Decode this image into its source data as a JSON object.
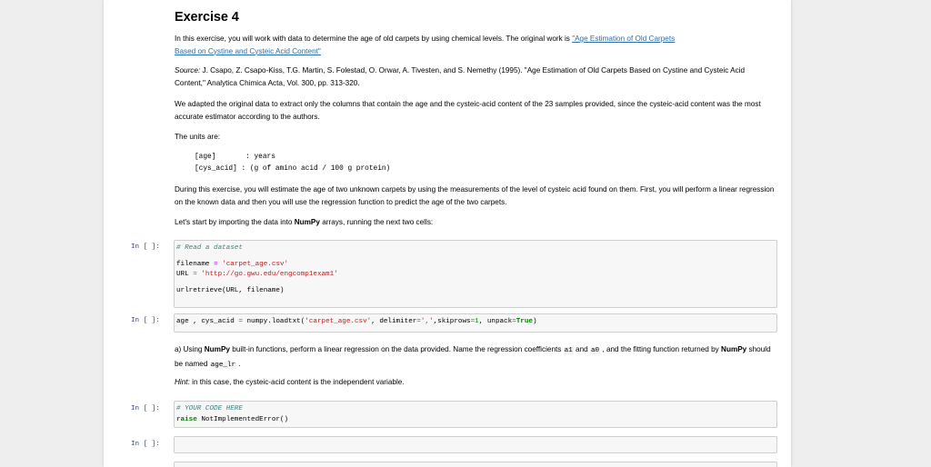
{
  "exercise": {
    "title": "Exercise 4",
    "intro": {
      "text_before_link": "In this exercise, you will work with data to determine the age of old carpets by using chemical levels. The original work is ",
      "link_line1": "\"Age Estimation of Old Carpets",
      "link_line2": "Based on Cystine and Cysteic Acid Content\""
    },
    "source": {
      "label": "Source:",
      "text": " J. Csapo, Z. Csapo-Kiss, T.G. Martin, S. Folestad, O. Orwar, A. Tivesten, and S. Nemethy (1995). \"Age Estimation of Old Carpets Based on Cystine and Cysteic Acid Content,\" Analytica Chimica Acta, Vol. 300, pp. 313-320."
    },
    "adapted": "We adapted the original data to extract only the columns that contain the age and the cysteic-acid content of the 23 samples provided, since the cysteic-acid content was the most accurate estimator according to the authors.",
    "units_label": "The units are:",
    "units_lines": [
      "[age]       : years",
      "[cys_acid] : (g of amino acid / 100 g protein)"
    ],
    "during": "During this exercise, you will estimate the age of two unknown carpets by using the measurements of the level of cysteic acid found on them. First, you will perform a linear regression on the known data and then you will use the regression function to predict the age of the two carpets.",
    "start": {
      "before": "Let's start by importing the data into ",
      "bold": "NumPy",
      "after": " arrays, running the next two cells:"
    },
    "task_a": {
      "p1": "a) Using ",
      "b1": "NumPy",
      "p2": " built-in functions, perform a linear regression on the data provided. Name the regression coefficients ",
      "c1": "a1",
      "p3": " and ",
      "c2": "a0",
      "p4": " , and the fitting function returned by ",
      "b2": "NumPy",
      "p5": " should be named ",
      "c3": "age_lr",
      "p6": " ."
    },
    "hint": {
      "label": "Hint:",
      "text": " in this case, the cysteic-acid content is the independent variable."
    }
  },
  "cells": [
    {
      "prompt": "In [ ]:",
      "comment": "# Read a dataset",
      "filename_var": "filename",
      "filename_eq": " = ",
      "filename_val": "'carpet_age.csv'",
      "url_var": "URL",
      "url_eq": " = ",
      "url_val": "'http://go.gwu.edu/engcomp1exam1'",
      "call": "urlretrieve(URL, filename)"
    },
    {
      "prompt": "In [ ]:",
      "pre": "age , cys_acid ",
      "eq": "=",
      "mid": " numpy.loadtxt(",
      "s1": "'carpet_age.csv'",
      "mid2": ", delimiter",
      "eq2": "=",
      "s2": "','",
      "mid3": ",skiprows",
      "eq3": "=",
      "n1": "1",
      "mid4": ", unpack",
      "eq4": "=",
      "kwTrue": "True",
      "end": ")"
    },
    {
      "prompt": "In [ ]:",
      "comment": "# YOUR CODE HERE",
      "kw": "raise",
      "rest": " NotImplementedError()"
    },
    {
      "prompt": "In [ ]:",
      "content": ""
    },
    {
      "prompt": ""
    }
  ]
}
